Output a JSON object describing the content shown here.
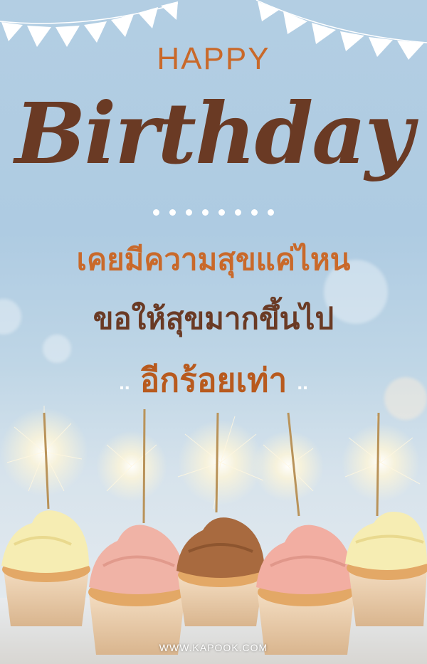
{
  "card": {
    "happy": "HAPPY",
    "birthday": "Birthday",
    "line1": "เคยมีความสุขแค่ไหน",
    "line2": "ขอให้สุขมากขึ้นไป",
    "line3": "อีกร้อยเท่า",
    "line3_prefix": "..",
    "line3_suffix": "..",
    "watermark": "WWW.KAPOOK.COM"
  },
  "colors": {
    "background": "#b3cee3",
    "accent_orange": "#c9692a",
    "accent_brown": "#6a3a24"
  },
  "decorations": {
    "bunting": "pennant-flags",
    "dot_count": 8,
    "cupcakes": [
      "yellow-frosting",
      "pink-frosting",
      "chocolate-frosting",
      "pink-frosting",
      "yellow-frosting"
    ],
    "sparklers": "sparkler-candles"
  }
}
